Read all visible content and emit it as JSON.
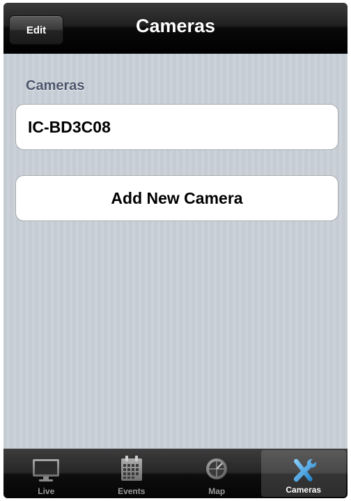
{
  "navbar": {
    "title": "Cameras",
    "edit_label": "Edit"
  },
  "section": {
    "header": "Cameras"
  },
  "cameras": [
    {
      "name": "IC-BD3C08"
    }
  ],
  "add_camera_label": "Add New Camera",
  "tabs": [
    {
      "label": "Live",
      "icon": "tv-icon",
      "selected": false
    },
    {
      "label": "Events",
      "icon": "calendar-icon",
      "selected": false
    },
    {
      "label": "Map",
      "icon": "map-icon",
      "selected": false
    },
    {
      "label": "Cameras",
      "icon": "tools-icon",
      "selected": true
    }
  ],
  "colors": {
    "tab_selected_icon": "#3aa9e6",
    "section_header": "#4c566c"
  }
}
